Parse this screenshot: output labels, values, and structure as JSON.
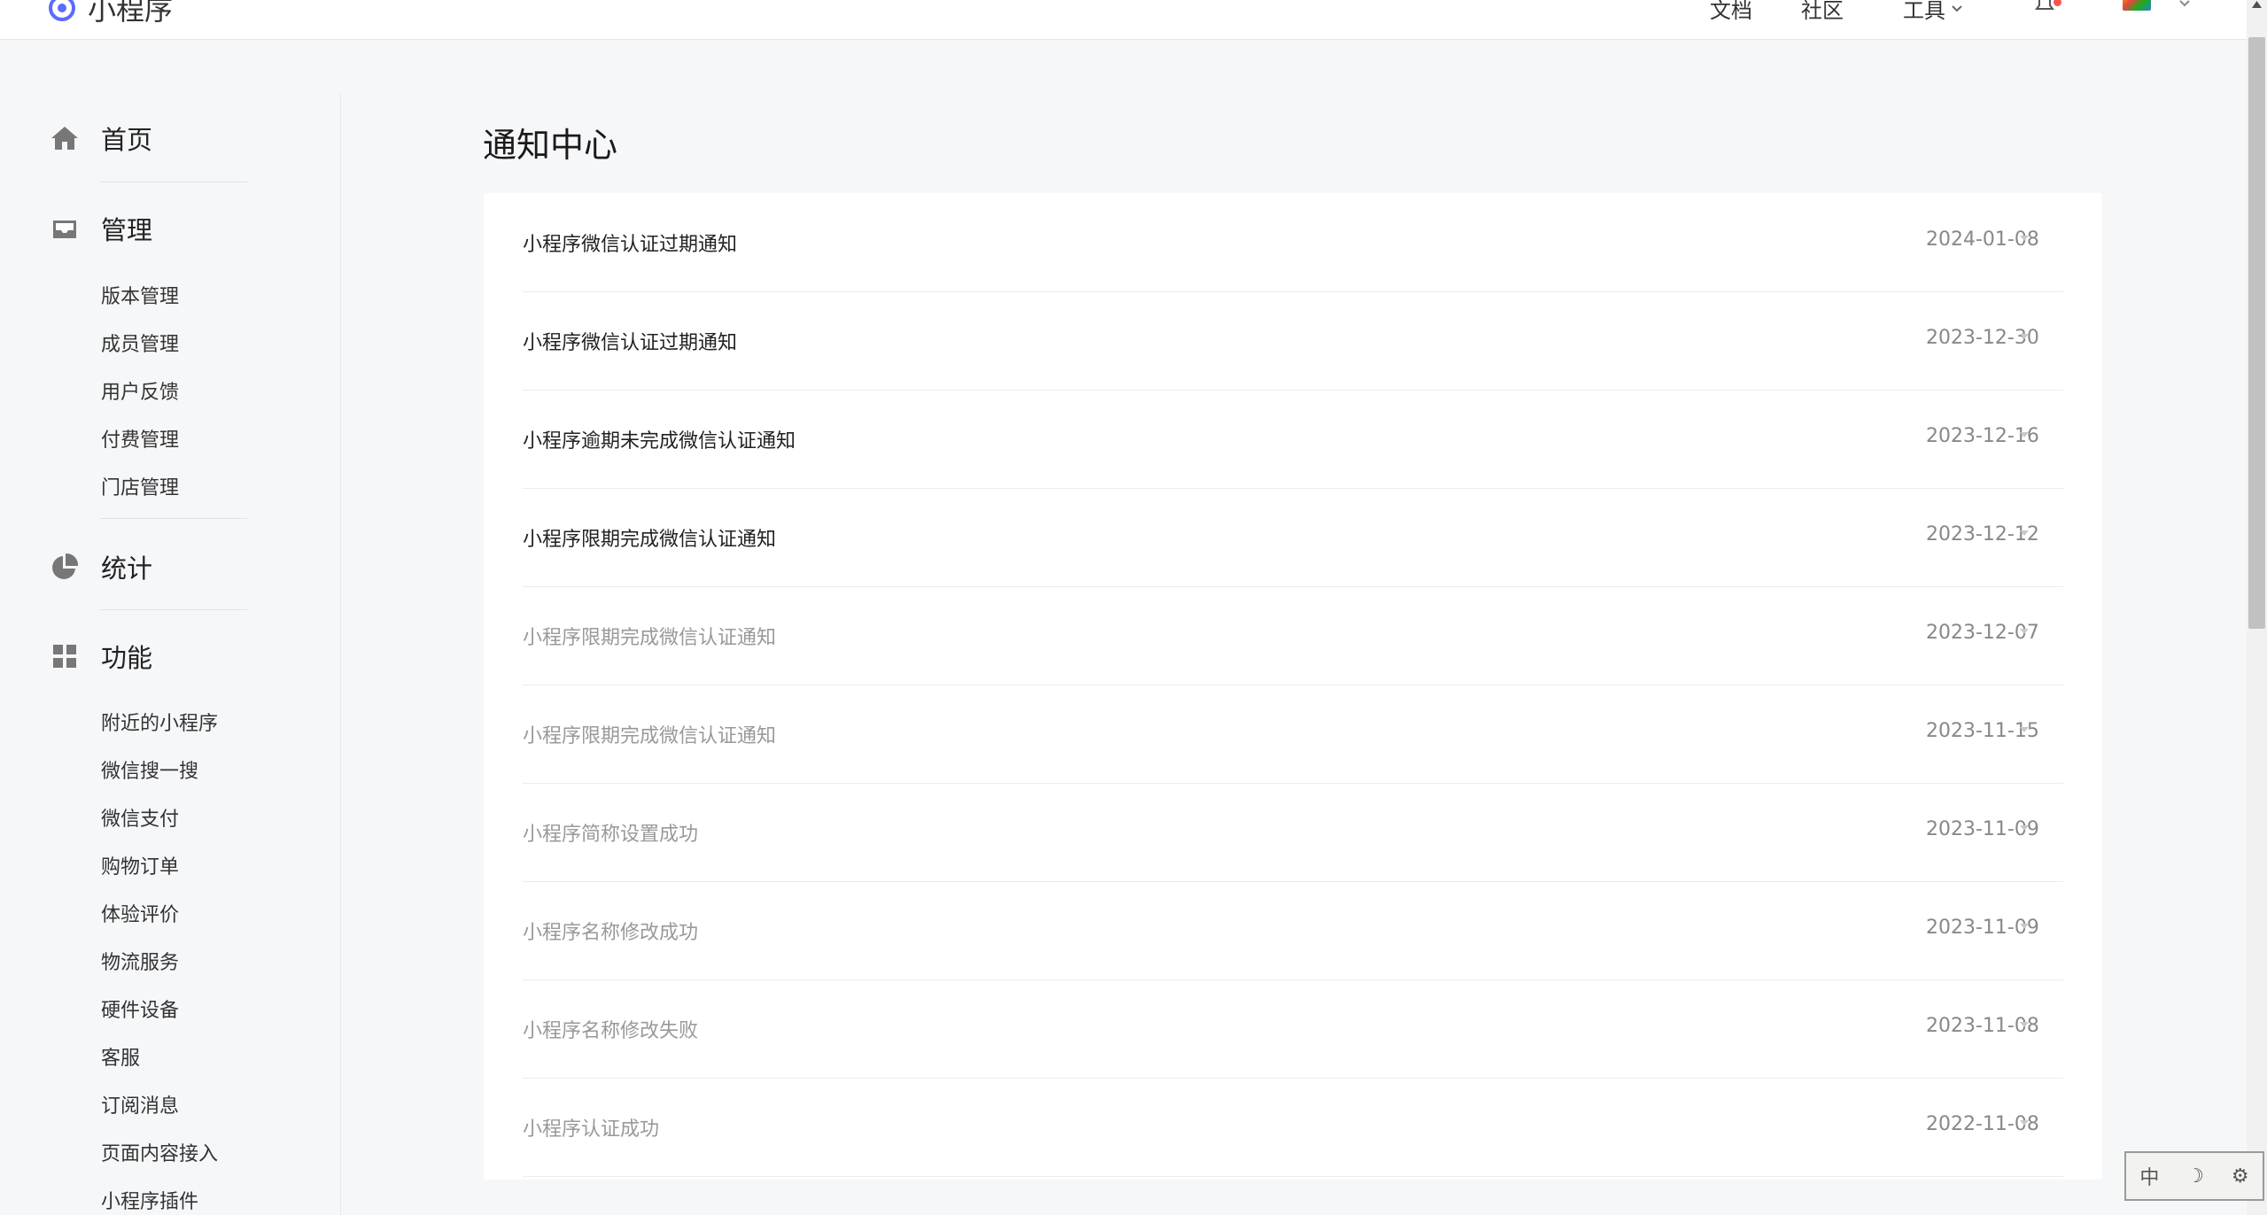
{
  "header": {
    "logo_text": "小程序",
    "nav": {
      "docs": "文档",
      "community": "社区",
      "tools": "工具"
    },
    "icons": {
      "bell": "bell-icon",
      "avatar": "avatar-image"
    }
  },
  "sidebar": {
    "groups": [
      {
        "label": "首页",
        "icon": "home-icon"
      },
      {
        "label": "管理",
        "icon": "inbox-icon",
        "items": [
          "版本管理",
          "成员管理",
          "用户反馈",
          "付费管理",
          "门店管理"
        ]
      },
      {
        "label": "统计",
        "icon": "pie-chart-icon"
      },
      {
        "label": "功能",
        "icon": "grid-icon",
        "items": [
          "附近的小程序",
          "微信搜一搜",
          "微信支付",
          "购物订单",
          "体验评价",
          "物流服务",
          "硬件设备",
          "客服",
          "订阅消息",
          "页面内容接入",
          "小程序插件"
        ]
      }
    ]
  },
  "main": {
    "title": "通知中心",
    "notifications": [
      {
        "title": "小程序微信认证过期通知",
        "date": "2024-01-08"
      },
      {
        "title": "小程序微信认证过期通知",
        "date": "2023-12-30"
      },
      {
        "title": "小程序逾期未完成微信认证通知",
        "date": "2023-12-16"
      },
      {
        "title": "小程序限期完成微信认证通知",
        "date": "2023-12-12"
      },
      {
        "title": "小程序限期完成微信认证通知",
        "date": "2023-12-07"
      },
      {
        "title": "小程序限期完成微信认证通知",
        "date": "2023-11-15"
      },
      {
        "title": "小程序简称设置成功",
        "date": "2023-11-09"
      },
      {
        "title": "小程序名称修改成功",
        "date": "2023-11-09"
      },
      {
        "title": "小程序名称修改失败",
        "date": "2023-11-08"
      },
      {
        "title": "小程序认证成功",
        "date": "2022-11-08"
      }
    ]
  },
  "ime": {
    "lang": "中",
    "moon": "☽",
    "settings": "⚙"
  },
  "colors": {
    "accent": "#07c160",
    "logo": "#5b6bff",
    "unread_text": "#222222",
    "read_text": "#999999",
    "date": "#888888"
  }
}
